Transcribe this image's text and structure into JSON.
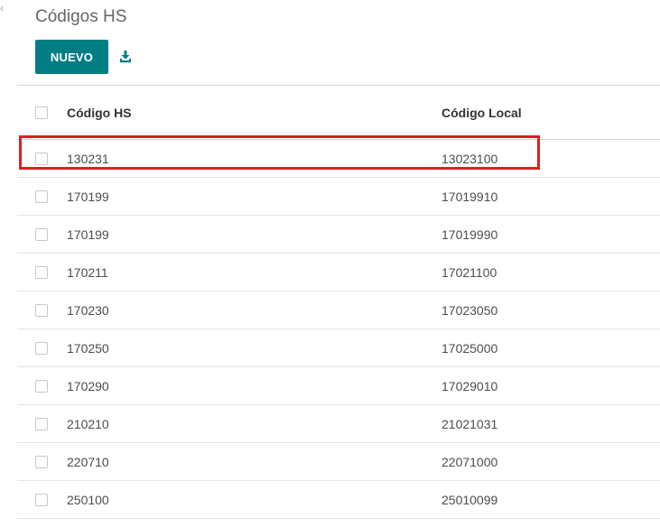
{
  "page": {
    "title": "Códigos HS"
  },
  "toolbar": {
    "new_label": "NUEVO",
    "download_icon": "download-icon"
  },
  "table": {
    "columns": [
      "Código HS",
      "Código Local"
    ],
    "rows": [
      {
        "hs": "130231",
        "local": "13023100"
      },
      {
        "hs": "170199",
        "local": "17019910"
      },
      {
        "hs": "170199",
        "local": "17019990"
      },
      {
        "hs": "170211",
        "local": "17021100"
      },
      {
        "hs": "170230",
        "local": "17023050"
      },
      {
        "hs": "170250",
        "local": "17025000"
      },
      {
        "hs": "170290",
        "local": "17029010"
      },
      {
        "hs": "210210",
        "local": "21021031"
      },
      {
        "hs": "220710",
        "local": "22071000"
      },
      {
        "hs": "250100",
        "local": "25010099"
      }
    ]
  },
  "colors": {
    "primary": "#017e84",
    "highlight": "#d62222"
  }
}
